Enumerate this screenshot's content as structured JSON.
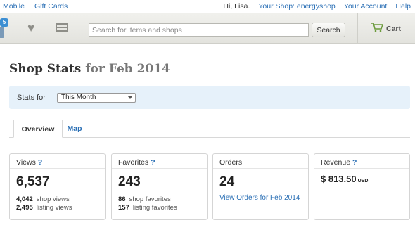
{
  "topbar": {
    "left_links": [
      "Mobile",
      "Gift Cards"
    ],
    "greeting": "Hi, Lisa.",
    "your_shop": "Your Shop: energyshop",
    "your_account": "Your Account",
    "help": "Help"
  },
  "nav": {
    "notification_count": "5",
    "icons": [
      "favorites-heart-icon",
      "conversations-icon",
      "cart-icon"
    ],
    "search_placeholder": "Search for items and shops",
    "search_button": "Search",
    "cart_label": "Cart"
  },
  "page": {
    "title": "Shop Stats",
    "title_for": "for",
    "period": "Feb 2014"
  },
  "filter": {
    "label": "Stats for",
    "selected": "This Month"
  },
  "tabs": [
    "Overview",
    "Map"
  ],
  "cards": {
    "views": {
      "label": "Views",
      "help": "?",
      "value": "6,537",
      "shop_views_num": "4,042",
      "shop_views_label": "shop views",
      "listing_views_num": "2,495",
      "listing_views_label": "listing views"
    },
    "favorites": {
      "label": "Favorites",
      "help": "?",
      "value": "243",
      "shop_fav_num": "86",
      "shop_fav_label": "shop favorites",
      "listing_fav_num": "157",
      "listing_fav_label": "listing favorites"
    },
    "orders": {
      "label": "Orders",
      "value": "24",
      "link": "View Orders for Feb 2014"
    },
    "revenue": {
      "label": "Revenue",
      "help": "?",
      "value": "$ 813.50",
      "currency": "USD"
    }
  },
  "colors": {
    "link": "#2a6fb5",
    "filter_bg": "#e6f1fa",
    "badge": "#3d8fd3"
  }
}
